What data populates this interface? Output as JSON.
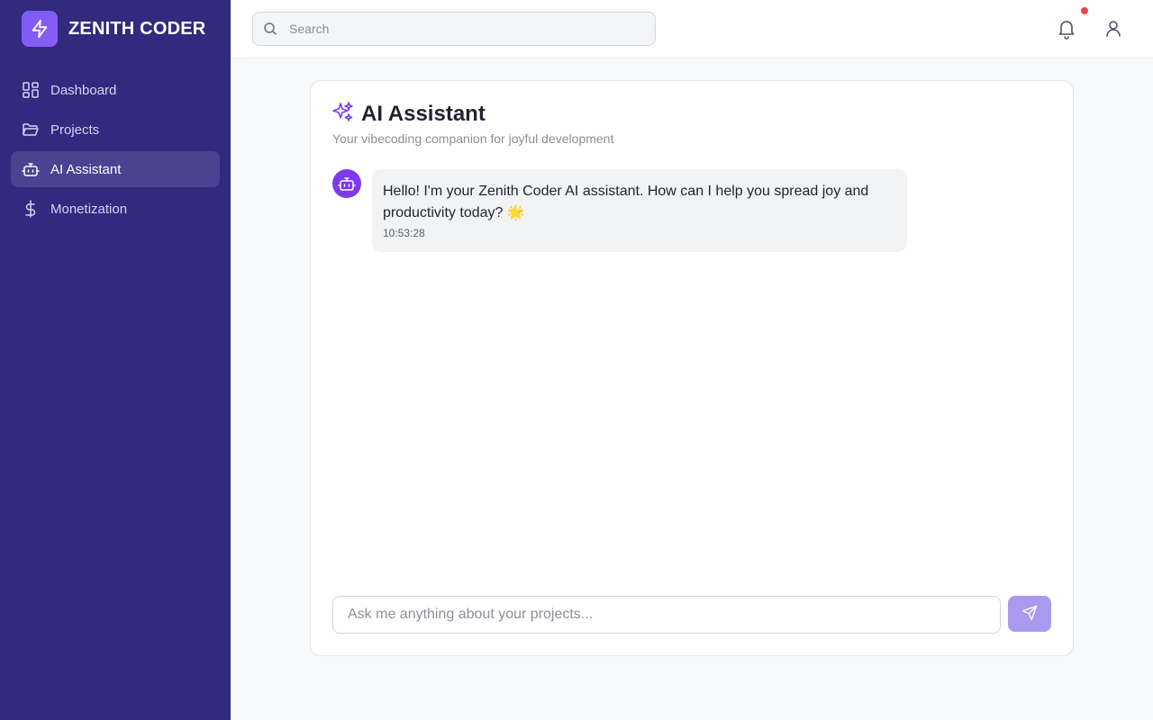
{
  "brand": {
    "name": "ZENITH CODER",
    "logo_icon": "bolt-icon"
  },
  "sidebar": {
    "items": [
      {
        "label": "Dashboard",
        "icon": "grid-icon",
        "active": false
      },
      {
        "label": "Projects",
        "icon": "folder-icon",
        "active": false
      },
      {
        "label": "AI Assistant",
        "icon": "robot-icon",
        "active": true
      },
      {
        "label": "Monetization",
        "icon": "dollar-icon",
        "active": false
      }
    ]
  },
  "topbar": {
    "search": {
      "placeholder": "Search",
      "value": ""
    },
    "notifications_icon": "bell-icon",
    "has_unread": true,
    "user_icon": "user-icon"
  },
  "assistant": {
    "title": "AI Assistant",
    "subtitle": "Your vibecoding companion for joyful development",
    "title_icon": "sparkles-icon",
    "messages": [
      {
        "sender": "assistant",
        "text": "Hello! I'm your Zenith Coder AI assistant. How can I help you spread joy and productivity today? 🌟",
        "time": "10:53:28"
      }
    ],
    "input": {
      "placeholder": "Ask me anything about your projects...",
      "value": ""
    },
    "send_icon": "send-icon"
  },
  "colors": {
    "sidebar_bg": "#312a7e",
    "sidebar_active": "#4a4392",
    "accent": "#7c3aed",
    "send_button": "#a99af0",
    "notification_dot": "#ef4444"
  }
}
